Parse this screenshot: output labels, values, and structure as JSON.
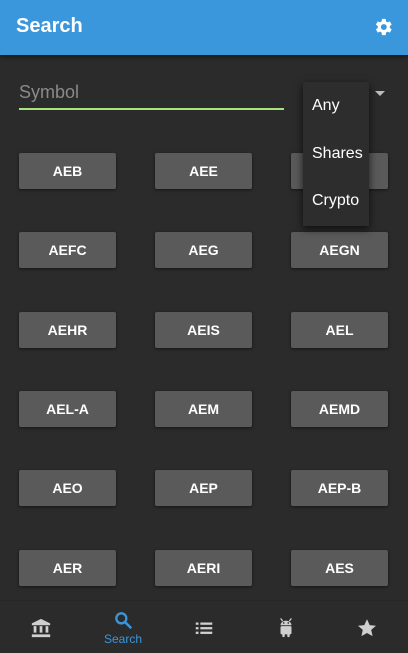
{
  "appbar": {
    "title": "Search",
    "settings_icon": "gear-icon"
  },
  "search": {
    "placeholder": "Symbol",
    "value": ""
  },
  "filter_menu": {
    "options": [
      "Any",
      "Shares",
      "Crypto"
    ]
  },
  "symbols": [
    "AEB",
    "AEE",
    "",
    "AEFC",
    "AEG",
    "AEGN",
    "AEHR",
    "AEIS",
    "AEL",
    "AEL-A",
    "AEM",
    "AEMD",
    "AEO",
    "AEP",
    "AEP-B",
    "AER",
    "AERI",
    "AES"
  ],
  "bottom_nav": {
    "items": [
      {
        "icon": "bank-icon",
        "label": ""
      },
      {
        "icon": "search-icon",
        "label": "Search",
        "active": true
      },
      {
        "icon": "list-icon",
        "label": ""
      },
      {
        "icon": "android-icon",
        "label": ""
      },
      {
        "icon": "star-icon",
        "label": ""
      }
    ]
  },
  "colors": {
    "appbar": "#3a97dc",
    "background": "#2b2b2b",
    "button": "#5a5a5a",
    "input_underline": "#a8e27a",
    "active_nav": "#3a97dc",
    "inactive_nav": "#cfcfcf"
  }
}
